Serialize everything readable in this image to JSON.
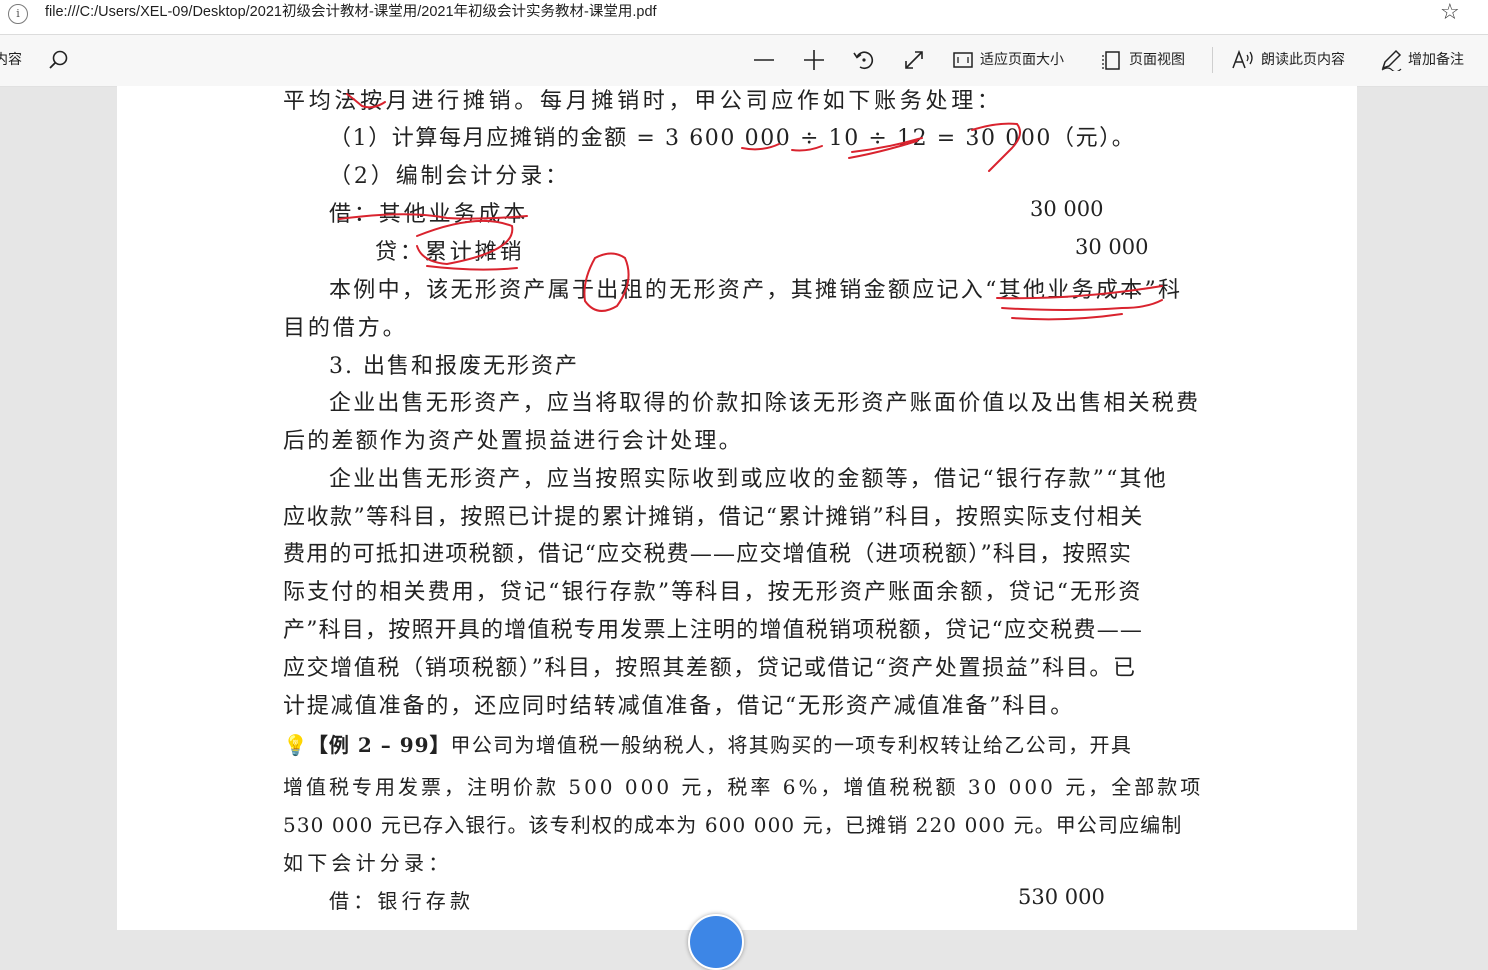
{
  "address_bar": {
    "url": "file:///C:/Users/XEL-09/Desktop/2021初级会计教材-课堂用/2021年初级会计实务教材-课堂用.pdf"
  },
  "toolbar": {
    "contents_label": "内容",
    "zoom_out_icon": "minus-icon",
    "zoom_in_icon": "plus-icon",
    "rotate_icon": "rotate-icon",
    "fullscreen_icon": "expand-icon",
    "fit_page_label": "适应页面大小",
    "page_view_label": "页面视图",
    "read_aloud_label": "朗读此页内容",
    "add_note_label": "增加备注"
  },
  "document": {
    "lines": [
      "平均法按月进行摊销。每月摊销时，甲公司应作如下账务处理：",
      "（1）计算每月应摊销的金额 = 3 600 000 ÷ 10 ÷ 12 = 30 000（元）。",
      "（2）编制会计分录：",
      "借：其他业务成本",
      "30 000",
      "贷：累计摊销",
      "30 000",
      "本例中，该无形资产属于出租的无形资产，其摊销金额应记入“其他业务成本”科",
      "目的借方。",
      "3. 出售和报废无形资产",
      "企业出售无形资产，应当将取得的价款扣除该无形资产账面价值以及出售相关税费",
      "后的差额作为资产处置损益进行会计处理。",
      "企业出售无形资产，应当按照实际收到或应收的金额等，借记“银行存款”“其他",
      "应收款”等科目，按照已计提的累计摊销，借记“累计摊销”科目，按照实际支付相关",
      "费用的可抵扣进项税额，借记“应交税费——应交增值税（进项税额）”科目，按照实",
      "际支付的相关费用，贷记“银行存款”等科目，按无形资产账面余额，贷记“无形资",
      "产”科目，按照开具的增值税专用发票上注明的增值税销项税额，贷记“应交税费——",
      "应交增值税（销项税额）”科目，按照其差额，贷记或借记“资产处置损益”科目。已",
      "计提减值准备的，还应同时结转减值准备，借记“无形资产减值准备”科目。",
      "【例 2 – 99】",
      "甲公司为增值税一般纳税人，将其购买的一项专利权转让给乙公司，开具",
      "增值税专用发票，注明价款 500 000 元，税率 6%，增值税税额 30 000 元，全部款项",
      "530 000 元已存入银行。该专利权的成本为 600 000 元，已摊销 220 000 元。甲公司应编制",
      "如下会计分录：",
      "借：银行存款",
      "530 000"
    ]
  },
  "colors": {
    "ink_red": "#d9232e",
    "fab_blue": "#3d86e6"
  }
}
